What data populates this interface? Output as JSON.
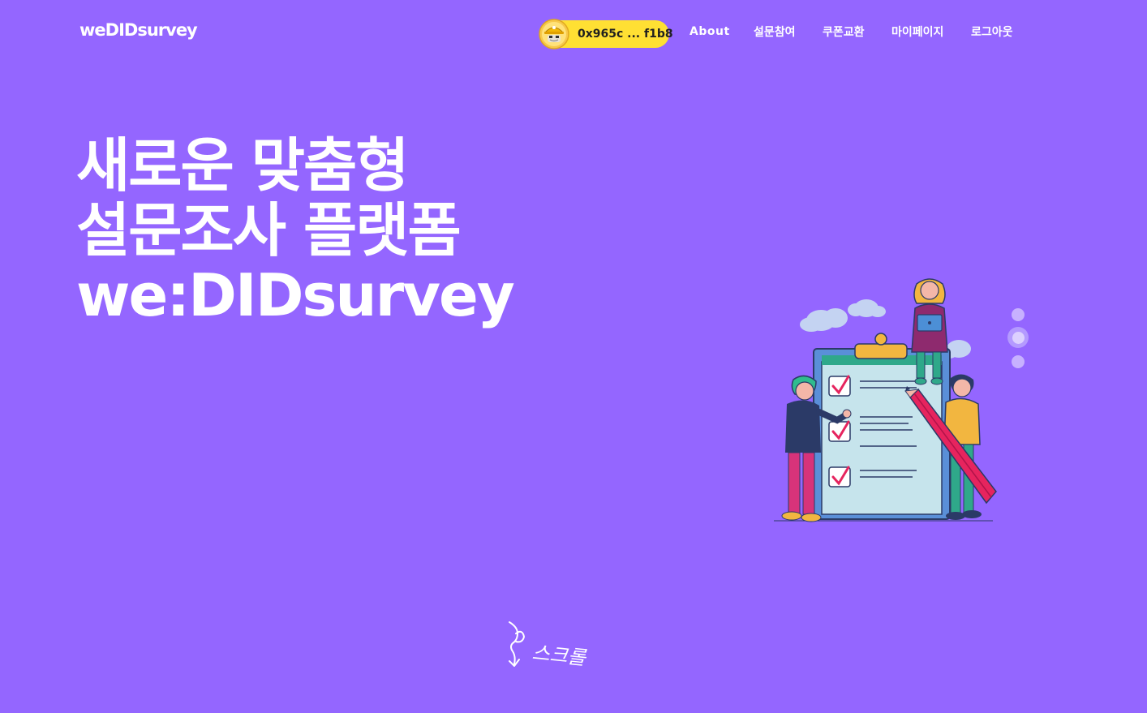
{
  "header": {
    "brand": "weDIDsurvey",
    "wallet": {
      "address": "0x965c ... f1b8",
      "avatar_icon": "miner-avatar-icon",
      "pill_color": "#ffe033"
    },
    "nav": [
      {
        "label": "About"
      },
      {
        "label": "설문참여"
      },
      {
        "label": "쿠폰교환"
      },
      {
        "label": "마이페이지"
      },
      {
        "label": "로그아웃"
      }
    ]
  },
  "hero": {
    "line1": "새로운 맞춤형",
    "line2": "설문조사 플랫폼",
    "line3": "we:DIDsurvey",
    "illustration_icon": "survey-checklist-illustration"
  },
  "carousel": {
    "active_index": 2,
    "count": 3
  },
  "scroll_hint": {
    "label": "스크롤",
    "icon": "scroll-down-arrow-icon"
  },
  "colors": {
    "background": "#9466ff",
    "accent": "#ffe033",
    "text": "#ffffff"
  }
}
